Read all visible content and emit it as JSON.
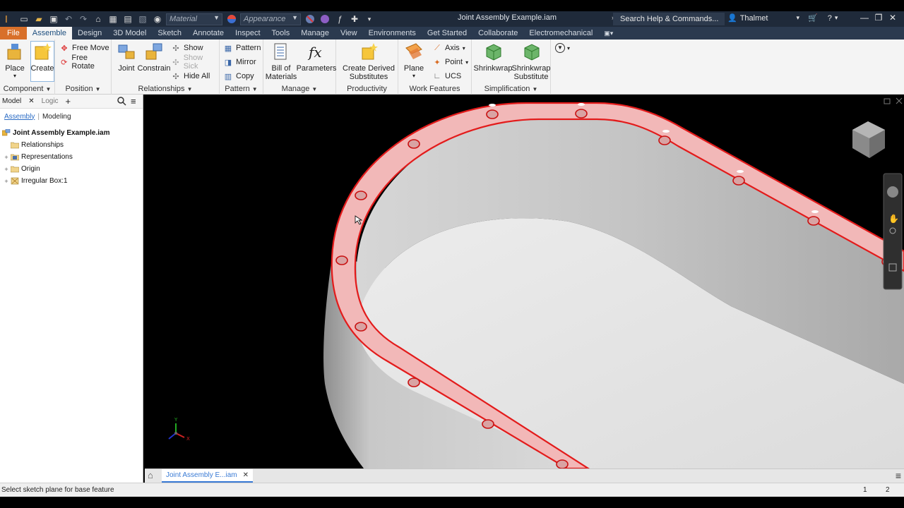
{
  "title_bar": {
    "material_placeholder": "Material",
    "appearance_placeholder": "Appearance",
    "document_title": "Joint Assembly Example.iam",
    "search_label": "Search Help & Commands...",
    "user_name": "Thalmet"
  },
  "menu": {
    "file": "File",
    "tabs": [
      "Assemble",
      "Design",
      "3D Model",
      "Sketch",
      "Annotate",
      "Inspect",
      "Tools",
      "Manage",
      "View",
      "Environments",
      "Get Started",
      "Collaborate",
      "Electromechanical"
    ]
  },
  "ribbon": {
    "component": {
      "label": "Component",
      "place": "Place",
      "create": "Create"
    },
    "position": {
      "label": "Position",
      "free_move": "Free Move",
      "free_rotate": "Free Rotate"
    },
    "relationships": {
      "label": "Relationships",
      "joint": "Joint",
      "constrain": "Constrain",
      "show": "Show",
      "show_sick": "Show Sick",
      "hide_all": "Hide All"
    },
    "pattern": {
      "label": "Pattern",
      "pattern": "Pattern",
      "mirror": "Mirror",
      "copy": "Copy"
    },
    "manage": {
      "label": "Manage",
      "bom_line1": "Bill of",
      "bom_line2": "Materials",
      "parameters": "Parameters"
    },
    "productivity": {
      "label": "Productivity",
      "cds_line1": "Create Derived",
      "cds_line2": "Substitutes"
    },
    "work_features": {
      "label": "Work Features",
      "plane": "Plane",
      "axis": "Axis",
      "point": "Point",
      "ucs": "UCS"
    },
    "simplification": {
      "label": "Simplification",
      "shrinkwrap": "Shrinkwrap",
      "shrinkwrap_sub_line1": "Shrinkwrap",
      "shrinkwrap_sub_line2": "Substitute"
    }
  },
  "browser": {
    "tabs": {
      "model": "Model",
      "logic": "Logic"
    },
    "subtabs": {
      "assembly": "Assembly",
      "modeling": "Modeling"
    },
    "root": "Joint Assembly Example.iam",
    "items": [
      "Relationships",
      "Representations",
      "Origin",
      "Irregular Box:1"
    ]
  },
  "document_tab": "Joint Assembly E...iam",
  "status": {
    "message": "Select sketch plane for base feature",
    "count1": "1",
    "count2": "2"
  },
  "colors": {
    "accent_file": "#d8702a",
    "highlight_red": "#e31b1b",
    "face_highlight": "#f2b8b8",
    "title_bar": "#1f2a3a",
    "tab_bar": "#2b3a4f"
  }
}
